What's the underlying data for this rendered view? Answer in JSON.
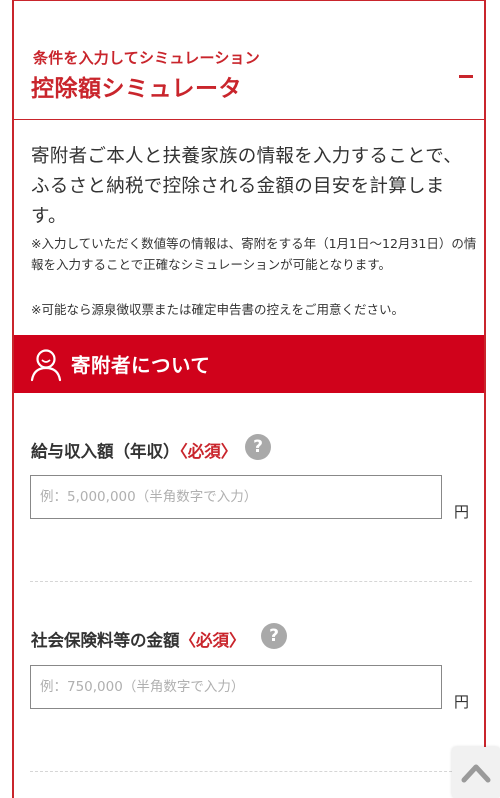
{
  "header": {
    "subtitle": "条件を入力してシミュレーション",
    "title": "控除額シミュレータ",
    "collapse_icon": "minus-icon"
  },
  "intro": {
    "text": "寄附者ご本人と扶養家族の情報を入力することで、ふるさと納税で控除される金額の目安を計算します。",
    "note1": "※入力していただく数値等の情報は、寄附をする年（1月1日〜12月31日）の情報を入力することで正確なシミュレーションが可能となります。",
    "note2": "※可能なら源泉徴収票または確定申告書の控えをご用意ください。"
  },
  "section": {
    "title": "寄附者について",
    "icon": "person-icon"
  },
  "fields": [
    {
      "label": "給与収入額（年収）",
      "required": "〈必須〉",
      "help": "?",
      "placeholder": "例：5,000,000（半角数字で入力）",
      "value": "",
      "unit": "円"
    },
    {
      "label": "社会保険料等の金額",
      "required": "〈必須〉",
      "help": "?",
      "placeholder": "例：750,000（半角数字で入力）",
      "value": "",
      "unit": "円"
    }
  ],
  "scroll_top": {
    "icon": "chevron-up-icon"
  },
  "colors": {
    "accent": "#c9252c",
    "section_bg": "#d0021b",
    "help_bg": "#a9a9a9"
  }
}
